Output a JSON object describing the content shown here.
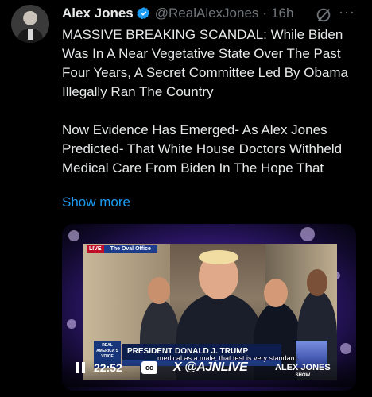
{
  "tweet": {
    "display_name": "Alex Jones",
    "handle": "@RealAlexJones",
    "separator": "·",
    "age": "16h",
    "paragraph1": "MASSIVE BREAKING SCANDAL: While Biden Was In A Near Vegetative State Over The Past Four Years, A Secret Committee Led By Obama Illegally Ran The Country",
    "paragraph2": "Now Evidence Has Emerged- As Alex Jones Predicted- That White House Doctors Withheld Medical Care From Biden In The Hope That",
    "show_more": "Show more",
    "more_options": "···",
    "accent_color": "#1d9bf0"
  },
  "video": {
    "live_label": "LIVE",
    "location_label": "The Oval Office",
    "network_logo": "REAL AMERICA'S VOICE",
    "chyron_name": "PRESIDENT DONALD J. TRUMP",
    "caption": "medical as a male, that test is very standard.",
    "time": "22:52",
    "cc_label": "cc",
    "brand": "X @AJNLIVE",
    "show_name": "ALEX JONES",
    "show_sub": "SHOW"
  },
  "icons": {
    "verified": "verified-badge-icon",
    "grok": "grok-icon",
    "pause": "pause-icon",
    "captions": "closed-captions-icon"
  }
}
